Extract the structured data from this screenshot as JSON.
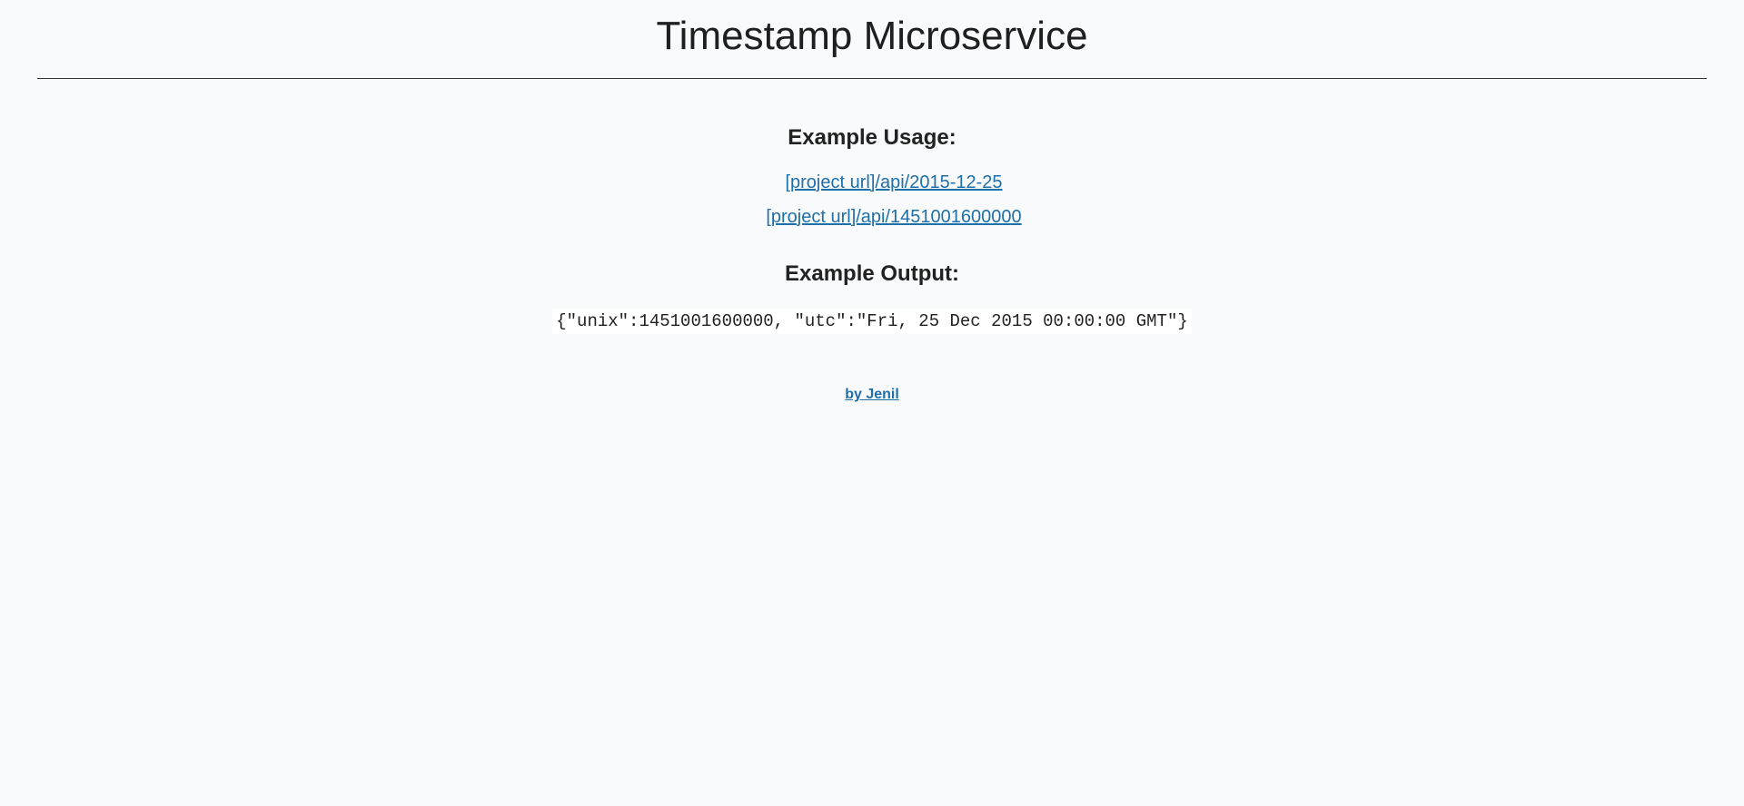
{
  "header": {
    "title": "Timestamp Microservice"
  },
  "usage": {
    "heading": "Example Usage:",
    "links": [
      "[project url]/api/2015-12-25",
      "[project url]/api/1451001600000"
    ]
  },
  "output": {
    "heading": "Example Output:",
    "code": "{\"unix\":1451001600000, \"utc\":\"Fri, 25 Dec 2015 00:00:00 GMT\"}"
  },
  "footer": {
    "author_link": "by Jenil"
  },
  "colors": {
    "background": "#f9fafb",
    "link": "#1f6fa8",
    "text": "#222222"
  }
}
